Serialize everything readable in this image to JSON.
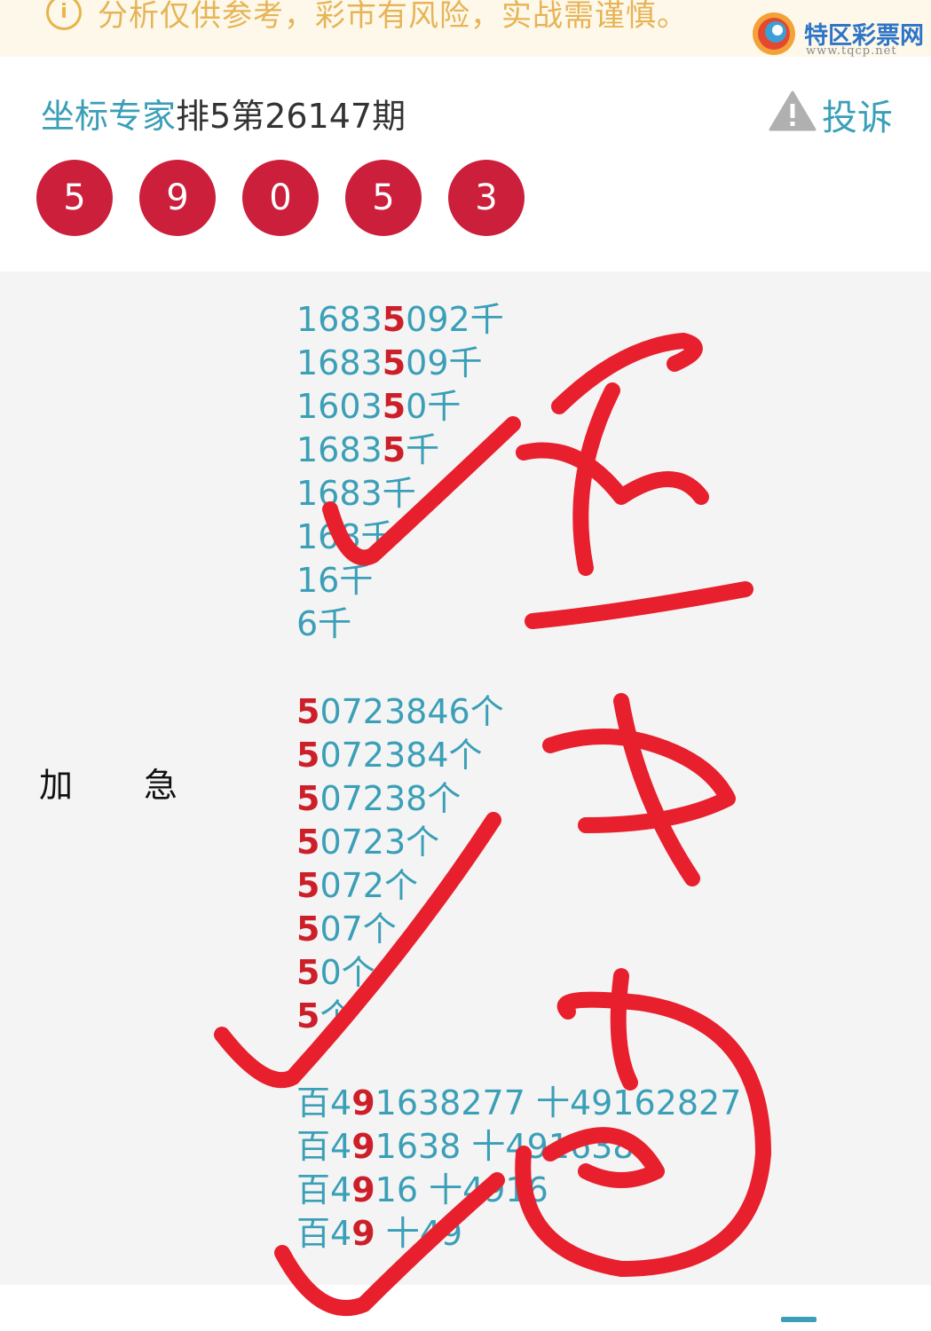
{
  "notice": {
    "icon": "info-icon",
    "text": "分析仅供参考，彩市有风险，实战需谨慎。"
  },
  "watermark": {
    "title": "特区彩票网",
    "url": "www.tqcp.net"
  },
  "header": {
    "expert_name": "坐标专家",
    "issue": "排5第26147期",
    "complain_label": "投诉",
    "balls": [
      "5",
      "9",
      "0",
      "5",
      "3"
    ]
  },
  "content": {
    "label_left": "加",
    "label_right": "急",
    "group1": [
      {
        "pre": "1683",
        "hl": "5",
        "post": "092千"
      },
      {
        "pre": "1683",
        "hl": "5",
        "post": "09千"
      },
      {
        "pre": "1603",
        "hl": "5",
        "post": "0千"
      },
      {
        "pre": "1683",
        "hl": "5",
        "post": "千"
      },
      {
        "pre": "1683千",
        "hl": "",
        "post": ""
      },
      {
        "pre": "168千",
        "hl": "",
        "post": ""
      },
      {
        "pre": "16千",
        "hl": "",
        "post": ""
      },
      {
        "pre": "6千",
        "hl": "",
        "post": ""
      }
    ],
    "group2": [
      {
        "pre": "",
        "hl": "5",
        "post": "0723846个"
      },
      {
        "pre": "",
        "hl": "5",
        "post": "072384个"
      },
      {
        "pre": "",
        "hl": "5",
        "post": "07238个"
      },
      {
        "pre": "",
        "hl": "5",
        "post": "0723个"
      },
      {
        "pre": "",
        "hl": "5",
        "post": "072个"
      },
      {
        "pre": "",
        "hl": "5",
        "post": "07个"
      },
      {
        "pre": "",
        "hl": "5",
        "post": "0个"
      },
      {
        "pre": "",
        "hl": "5",
        "post": "个"
      }
    ],
    "group3": [
      {
        "pre": "百4",
        "hl": "9",
        "post": "1638277 十49162827"
      },
      {
        "pre": "百4",
        "hl": "9",
        "post": "1638 十491638"
      },
      {
        "pre": "百4",
        "hl": "9",
        "post": "16 十4916"
      },
      {
        "pre": "百4",
        "hl": "9",
        "post": " 十49"
      }
    ]
  },
  "colors": {
    "accent_teal": "#3a9fb7",
    "ball_red": "#cc1f3b",
    "highlight_red": "#cc1f2a",
    "notice_bg": "#fdf8ea",
    "notice_text": "#e6b456",
    "handwriting_red": "#e8202e"
  }
}
